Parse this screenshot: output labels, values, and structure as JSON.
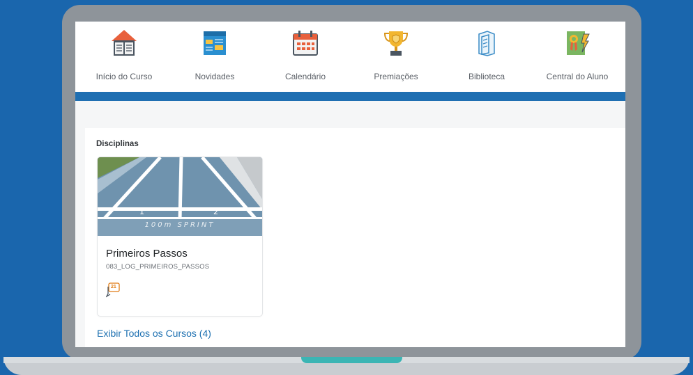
{
  "nav": {
    "items": [
      {
        "label": "Início do Curso",
        "icon": "home-book-icon"
      },
      {
        "label": "Novidades",
        "icon": "newspaper-icon"
      },
      {
        "label": "Calendário",
        "icon": "calendar-icon"
      },
      {
        "label": "Premiações",
        "icon": "trophy-icon"
      },
      {
        "label": "Biblioteca",
        "icon": "books-icon"
      },
      {
        "label": "Central do Aluno",
        "icon": "certificate-icon"
      }
    ]
  },
  "colors": {
    "background": "#1a66ad",
    "nav_bar": "#1f6fb2",
    "link": "#1b6fb0",
    "accent_teal": "#3bb5b4"
  },
  "main": {
    "section_title": "Disciplinas",
    "course": {
      "title": "Primeiros Passos",
      "code": "083_LOG_PRIMEIROS_PASSOS",
      "notification_count": "21",
      "image_lane_1": "1",
      "image_lane_2": "2",
      "image_text": "100m SPRINT"
    },
    "view_all": "Exibir Todos os Cursos (4)"
  }
}
